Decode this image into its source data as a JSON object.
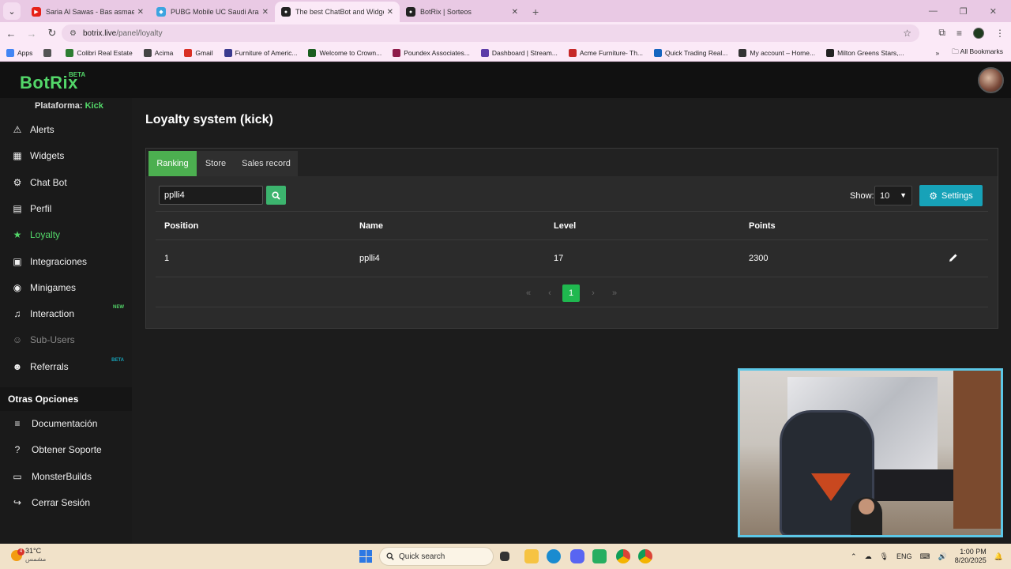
{
  "browser": {
    "tabs": [
      {
        "title": "Saria Al Sawas - Bas asmae Min",
        "favicon_color": "#e62117",
        "active": false
      },
      {
        "title": "PUBG Mobile UC Saudi Arabia |",
        "favicon_color": "#3ba4e0",
        "active": false
      },
      {
        "title": "The best ChatBot and Widgets",
        "favicon_color": "#222222",
        "active": true
      },
      {
        "title": "BotRix | Sorteos",
        "favicon_color": "#222222",
        "active": false
      }
    ],
    "url_domain": "botrix.live",
    "url_path": "/panel/loyalty",
    "bookmarks": [
      {
        "label": "Apps",
        "color": "#4285f4"
      },
      {
        "label": "",
        "color": "#555555"
      },
      {
        "label": "Colibri Real Estate",
        "color": "#2e7d32"
      },
      {
        "label": "Acima",
        "color": "#444444"
      },
      {
        "label": "Gmail",
        "color": "#d93025"
      },
      {
        "label": "Furniture of Americ...",
        "color": "#3b3b8f"
      },
      {
        "label": "Welcome to Crown...",
        "color": "#1b5e20"
      },
      {
        "label": "Poundex Associates...",
        "color": "#8e1c4a"
      },
      {
        "label": "Dashboard | Stream...",
        "color": "#5c3ca8"
      },
      {
        "label": "Acme Furniture- Th...",
        "color": "#c62828"
      },
      {
        "label": "Quick Trading Real...",
        "color": "#1565c0"
      },
      {
        "label": "My account – Home...",
        "color": "#333333"
      },
      {
        "label": "Milton Greens Stars,...",
        "color": "#222222"
      }
    ],
    "all_bookmarks": "All Bookmarks"
  },
  "app": {
    "logo": "BotRix",
    "logo_badge": "BETA",
    "platform_label": "Plataforma:",
    "platform_value": "Kick",
    "nav": [
      {
        "label": "Alerts",
        "icon": "⚠",
        "badge": "",
        "state": "normal"
      },
      {
        "label": "Widgets",
        "icon": "▦",
        "badge": "",
        "state": "normal"
      },
      {
        "label": "Chat Bot",
        "icon": "⚙",
        "badge": "",
        "state": "normal"
      },
      {
        "label": "Perfil",
        "icon": "▤",
        "badge": "",
        "state": "normal"
      },
      {
        "label": "Loyalty",
        "icon": "★",
        "badge": "",
        "state": "active"
      },
      {
        "label": "Integraciones",
        "icon": "▣",
        "badge": "",
        "state": "normal"
      },
      {
        "label": "Minigames",
        "icon": "◉",
        "badge": "",
        "state": "normal"
      },
      {
        "label": "Interaction",
        "icon": "♫",
        "badge": "NEW",
        "state": "normal"
      },
      {
        "label": "Sub-Users",
        "icon": "☺",
        "badge": "",
        "state": "disabled"
      },
      {
        "label": "Referrals",
        "icon": "☻",
        "badge": "BETA",
        "state": "normal"
      }
    ],
    "other_title": "Otras Opciones",
    "other_nav": [
      {
        "label": "Documentación",
        "icon": "≡"
      },
      {
        "label": "Obtener Soporte",
        "icon": "?"
      },
      {
        "label": "MonsterBuilds",
        "icon": "▭"
      },
      {
        "label": "Cerrar Sesión",
        "icon": "↪"
      }
    ],
    "page_title": "Loyalty system (kick)",
    "tabs": [
      "Ranking",
      "Store",
      "Sales record"
    ],
    "search_value": "pplli4",
    "show_label": "Show:",
    "show_value": "10",
    "settings_label": "Settings",
    "table": {
      "headers": [
        "Position",
        "Name",
        "Level",
        "Points"
      ],
      "rows": [
        {
          "position": "1",
          "name": "pplli4",
          "level": "17",
          "points": "2300"
        }
      ]
    },
    "pagination": {
      "first": "«",
      "prev": "‹",
      "current": "1",
      "next": "›",
      "last": "»"
    },
    "accent": "#53d769",
    "settings_color": "#17a2b8"
  },
  "taskbar": {
    "notif_count": "4",
    "temperature": "31°C",
    "weather_desc": "مشمس",
    "search_label": "Quick search",
    "lang": "ENG",
    "time": "1:00 PM",
    "date": "8/20/2025"
  }
}
